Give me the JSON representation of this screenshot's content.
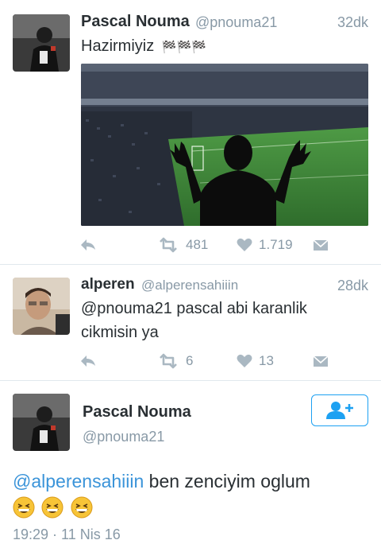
{
  "tweet1": {
    "name": "Pascal Nouma",
    "handle": "@pnouma21",
    "time": "32dk",
    "text": "Hazirmiyiz",
    "flags": "🏁🏁🏁",
    "retweet_count": "481",
    "like_count": "1.719"
  },
  "tweet2": {
    "name": "alperen",
    "handle": "@alperensahiiin",
    "time": "28dk",
    "text_line1": "@pnouma21 pascal abi karanlik",
    "text_line2": "cikmisin ya",
    "retweet_count": "6",
    "like_count": "13"
  },
  "tweet3": {
    "name": "Pascal Nouma",
    "handle": "@pnouma21",
    "mention": "@alperensahiiin",
    "text": " ben zenciyim oglum",
    "timestamp": "19:29 · 11 Nis 16"
  },
  "colors": {
    "accent": "#1da1f2",
    "secondary_text": "#8899a6",
    "pitch_green": "#3a8a3a"
  }
}
